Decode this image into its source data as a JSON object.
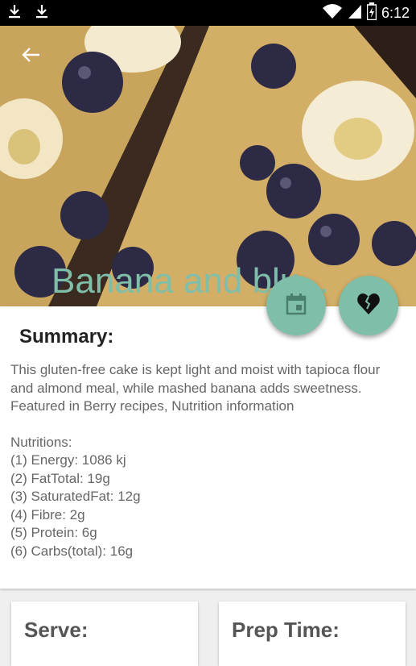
{
  "status_bar": {
    "time": "6:12",
    "left_icons": [
      "download-icon",
      "download-icon"
    ],
    "right_icons": [
      "wifi-icon",
      "signal-icon",
      "battery-icon"
    ]
  },
  "header": {
    "title": "Banana and blu...",
    "back_icon": "arrow-left-icon",
    "accent_color": "#7fbfaa"
  },
  "actions": {
    "calendar_icon": "calendar-icon",
    "favorite_icon": "broken-heart-icon"
  },
  "summary": {
    "title": "Summary:",
    "description": "This gluten-free cake is kept light and moist with tapioca flour and almond meal, while mashed banana adds sweetness. Featured in Berry recipes, Nutrition information",
    "nutrition_heading": "Nutritions:",
    "nutrition_items": [
      "(1) Energy: 1086 kj",
      "(2) FatTotal: 19g",
      "(3) SaturatedFat: 12g",
      "(4) Fibre: 2g",
      "(5) Protein: 6g",
      "(6) Carbs(total): 16g"
    ]
  },
  "info_cards": {
    "serve_title": "Serve:",
    "prep_title": "Prep Time:"
  }
}
